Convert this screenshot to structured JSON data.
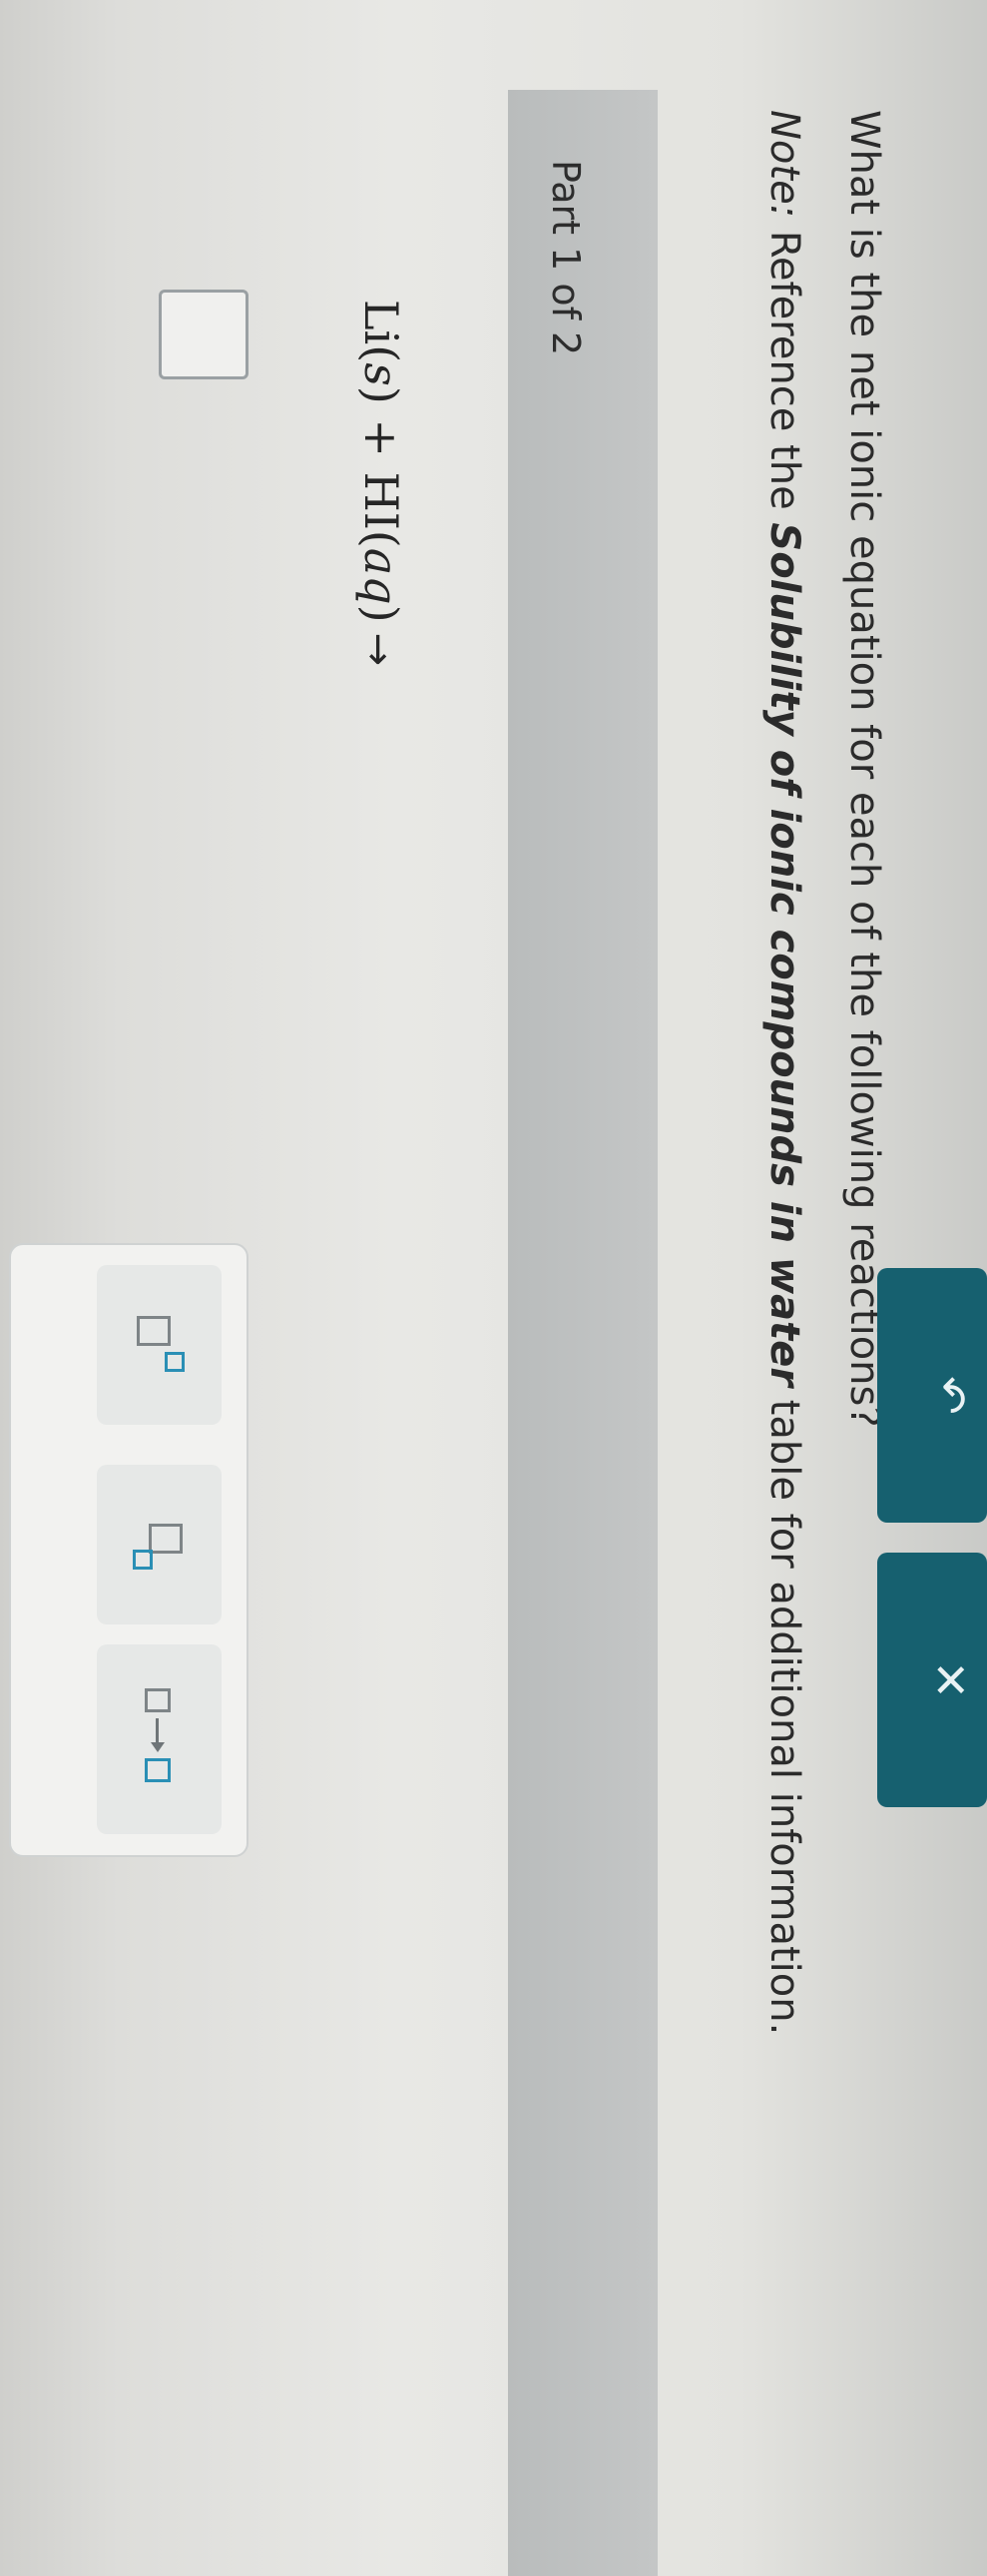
{
  "question": {
    "text": "What is the net ionic equation for each of the following reactions?"
  },
  "note": {
    "label": "Note:",
    "before": " Reference the ",
    "emphasis": "Solubility of ionic compounds in water",
    "after": " table for additional information."
  },
  "part": {
    "label": "Part 1 of 2"
  },
  "equation": {
    "reactant1": "Li(",
    "reactant1_state": "s",
    "reactant1_close": ")",
    "plus": " + ",
    "reactant2": "HI(",
    "reactant2_state": "aq",
    "reactant2_close": ")",
    "arrow": "→"
  },
  "toolbar": {
    "buttons": [
      {
        "name": "superscript",
        "icon": "superscript-box-icon"
      },
      {
        "name": "subscript",
        "icon": "subscript-box-icon"
      },
      {
        "name": "reaction-arrow",
        "icon": "box-arrow-box-icon"
      }
    ],
    "undo_glyph": "↶",
    "clear_glyph": "✕"
  },
  "colors": {
    "action_button": "#16606f",
    "placeholder_square_accent": "#2a8fb5",
    "part_band": "#bfc1c1"
  }
}
